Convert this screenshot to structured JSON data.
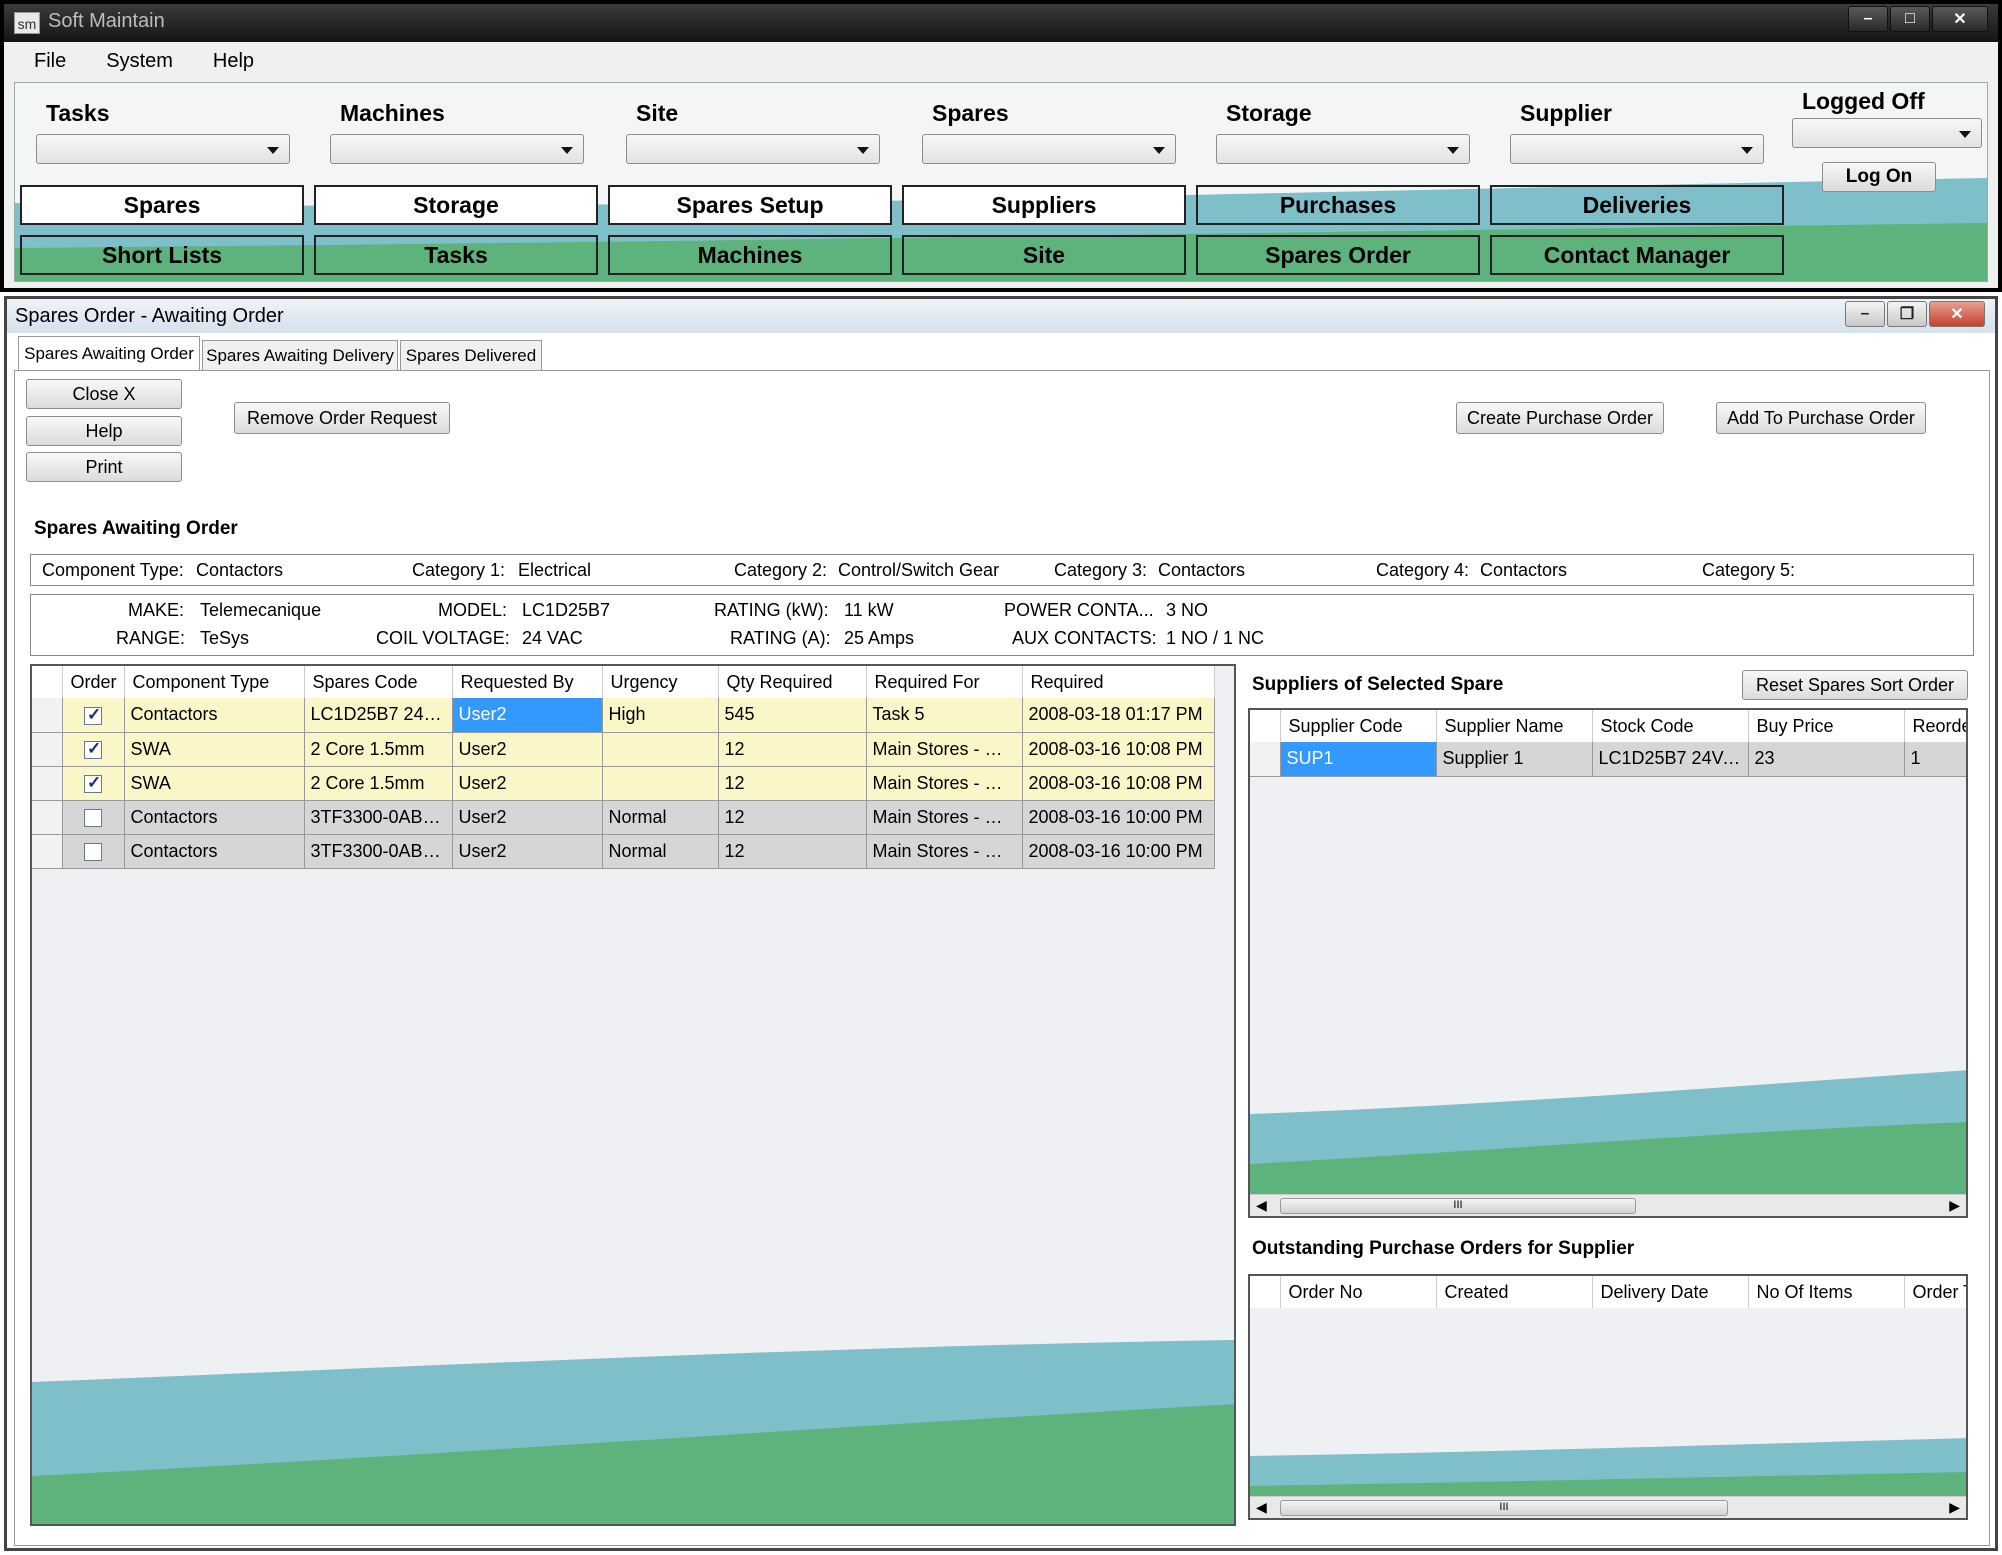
{
  "app": {
    "title": "Soft Maintain",
    "icon_text": "sm",
    "menu": [
      "File",
      "System",
      "Help"
    ]
  },
  "top_selectors": [
    {
      "label": "Tasks"
    },
    {
      "label": "Machines"
    },
    {
      "label": "Site"
    },
    {
      "label": "Spares"
    },
    {
      "label": "Storage"
    },
    {
      "label": "Supplier"
    }
  ],
  "login": {
    "status": "Logged Off",
    "button": "Log On"
  },
  "nav_row1": [
    "Spares",
    "Storage",
    "Spares Setup",
    "Suppliers",
    "Purchases",
    "Deliveries"
  ],
  "nav_row2": [
    "Short Lists",
    "Tasks",
    "Machines",
    "Site",
    "Spares Order",
    "Contact Manager"
  ],
  "child_window": {
    "title": "Spares Order - Awaiting Order",
    "tabs": [
      "Spares Awaiting Order",
      "Spares Awaiting Delivery",
      "Spares Delivered"
    ],
    "side_buttons": [
      "Close X",
      "Help",
      "Print"
    ],
    "remove_button": "Remove Order Request",
    "create_po_button": "Create Purchase Order",
    "add_po_button": "Add To Purchase Order",
    "section_title": "Spares Awaiting Order",
    "categories": {
      "component_type_label": "Component Type:",
      "component_type": "Contactors",
      "cat1_label": "Category 1:",
      "cat1": "Electrical",
      "cat2_label": "Category 2:",
      "cat2": "Control/Switch Gear",
      "cat3_label": "Category 3:",
      "cat3": "Contactors",
      "cat4_label": "Category 4:",
      "cat4": "Contactors",
      "cat5_label": "Category 5:",
      "cat5": ""
    },
    "specs": {
      "make_label": "MAKE:",
      "make": "Telemecanique",
      "range_label": "RANGE:",
      "range": "TeSys",
      "model_label": "MODEL:",
      "model": "LC1D25B7",
      "coil_label": "COIL VOLTAGE:",
      "coil": "24 VAC",
      "rkw_label": "RATING (kW):",
      "rkw": "11 kW",
      "ra_label": "RATING (A):",
      "ra": "25 Amps",
      "power_label": "POWER CONTA...",
      "power": "3 NO",
      "aux_label": "AUX CONTACTS:",
      "aux": "1 NO / 1 NC"
    },
    "orders_table": {
      "columns": [
        "Order",
        "Component Type",
        "Spares Code",
        "Requested By",
        "Urgency",
        "Qty Required",
        "Required For",
        "Required"
      ],
      "rows": [
        {
          "order": true,
          "type": "Contactors",
          "code": "LC1D25B7 24V...",
          "by": "User2",
          "urgency": "High",
          "qty": "545",
          "for": "Task 5",
          "req": "2008-03-18 01:17 PM"
        },
        {
          "order": true,
          "type": "SWA",
          "code": "2 Core 1.5mm",
          "by": "User2",
          "urgency": "",
          "qty": "12",
          "for": "Main Stores - Ra...",
          "req": "2008-03-16 10:08 PM"
        },
        {
          "order": true,
          "type": "SWA",
          "code": "2 Core 1.5mm",
          "by": "User2",
          "urgency": "",
          "qty": "12",
          "for": "Main Stores - Ra...",
          "req": "2008-03-16 10:08 PM"
        },
        {
          "order": false,
          "type": "Contactors",
          "code": "3TF3300-0AB0 ...",
          "by": "User2",
          "urgency": "Normal",
          "qty": "12",
          "for": "Main Stores - Ra...",
          "req": "2008-03-16 10:00 PM"
        },
        {
          "order": false,
          "type": "Contactors",
          "code": "3TF3300-0AB0 ...",
          "by": "User2",
          "urgency": "Normal",
          "qty": "12",
          "for": "Main Stores - Ra...",
          "req": "2008-03-16 10:00 PM"
        }
      ]
    },
    "suppliers_title": "Suppliers of Selected Spare",
    "reset_button": "Reset Spares Sort Order",
    "suppliers_table": {
      "columns": [
        "Supplier Code",
        "Supplier Name",
        "Stock Code",
        "Buy Price",
        "Reorde"
      ],
      "rows": [
        {
          "code": "SUP1",
          "name": "Supplier 1",
          "stock": "LC1D25B7 24VA...",
          "price": "23",
          "reorder": "1"
        }
      ]
    },
    "po_title": "Outstanding Purchase Orders for Supplier",
    "po_table": {
      "columns": [
        "Order No",
        "Created",
        "Delivery Date",
        "No Of Items",
        "Order T"
      ]
    },
    "scroll_grip": "III"
  },
  "colors": {
    "teal": "#7fbfc9",
    "green": "#5db37b",
    "highlight_row": "#faf6c8",
    "grey_row": "#d6d6d6",
    "selection": "#3399ff"
  }
}
